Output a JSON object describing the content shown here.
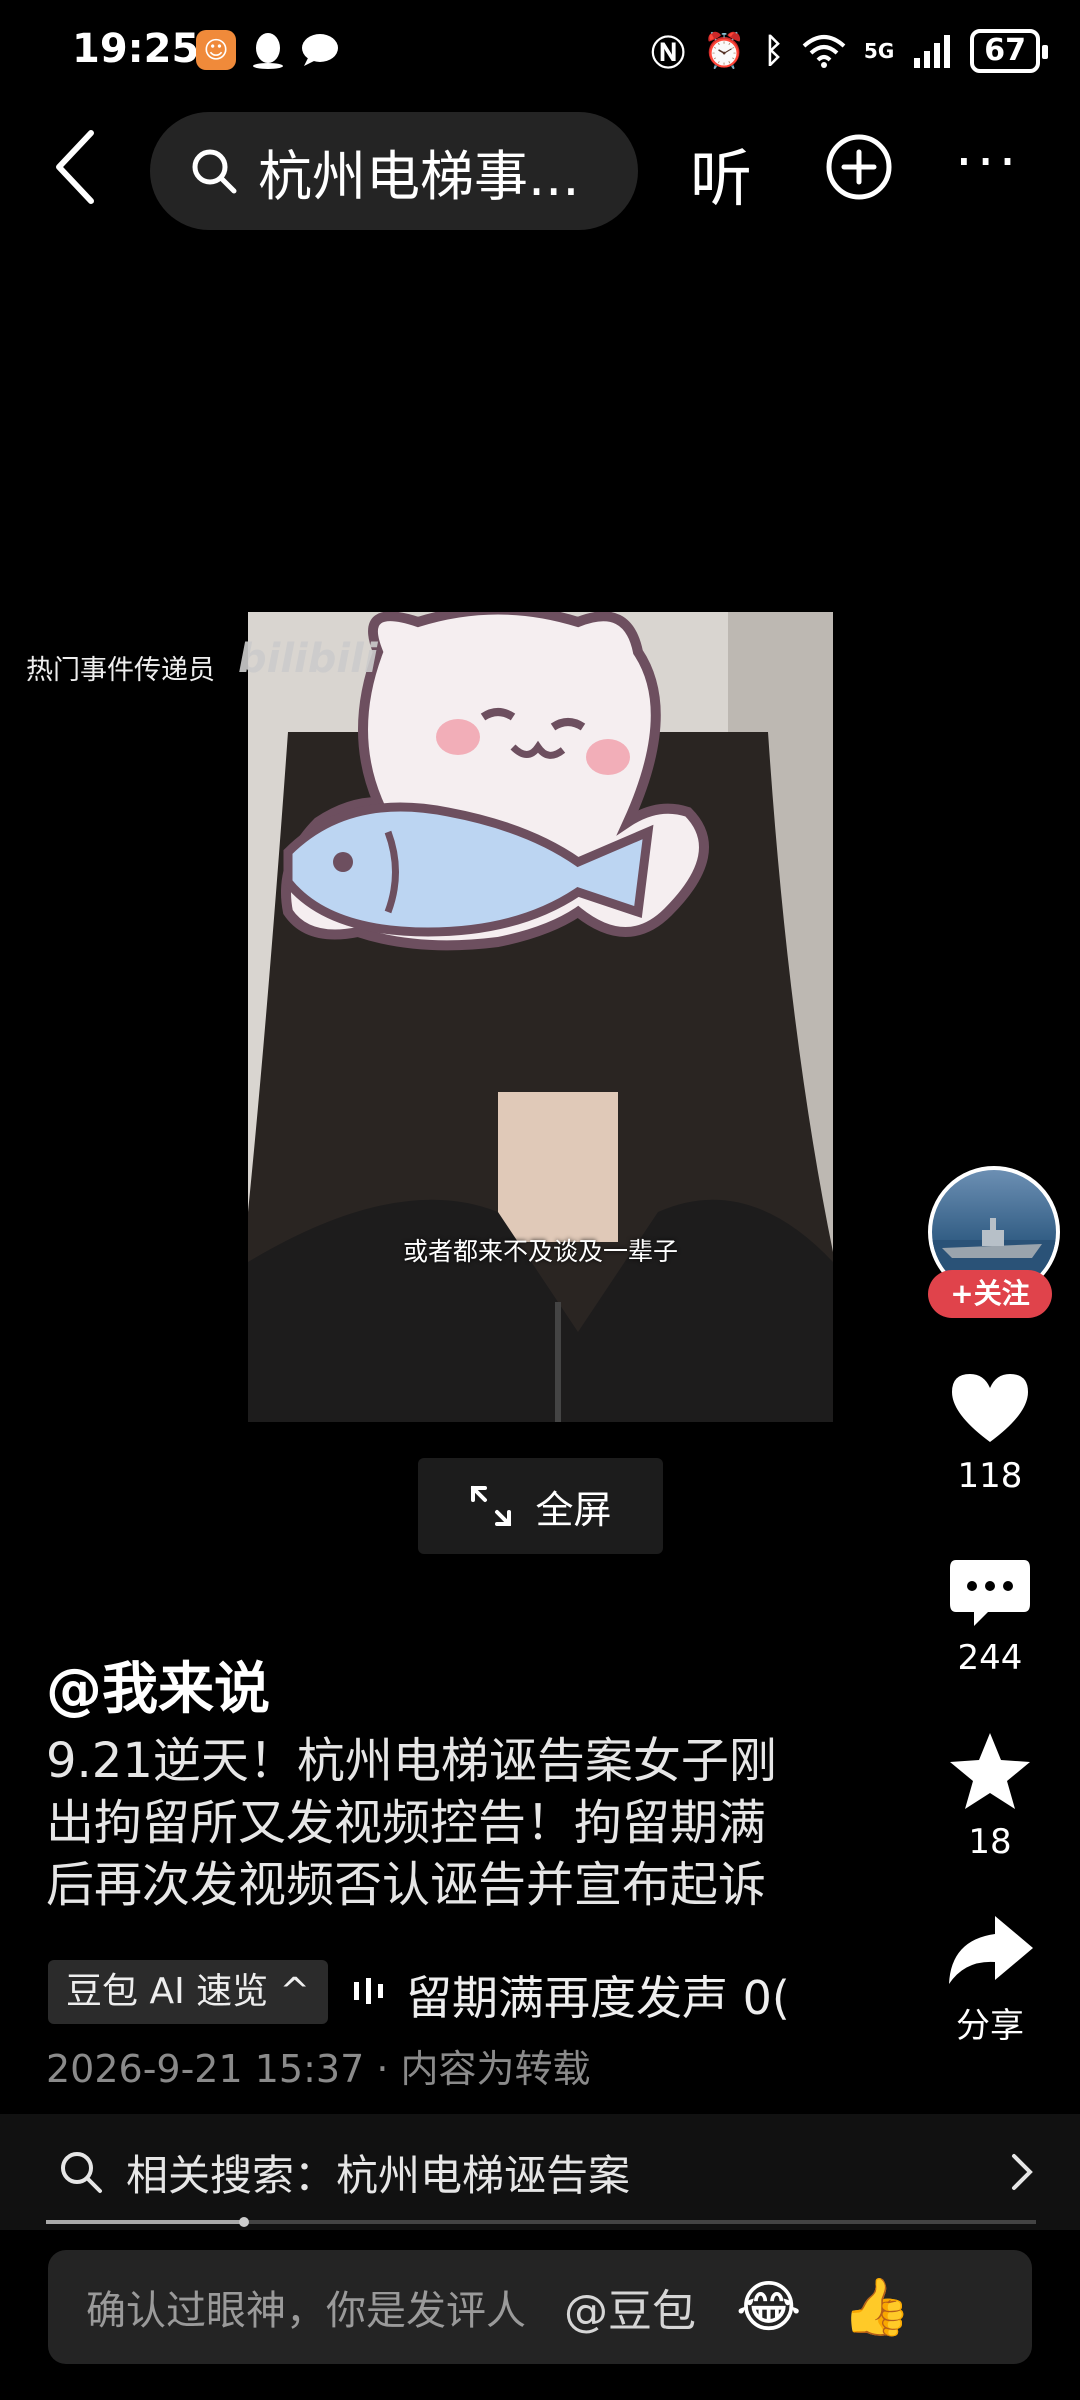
{
  "status_bar": {
    "time": "19:25",
    "network": "5G",
    "battery": "67"
  },
  "header": {
    "search_text": "杭州电梯事...",
    "listen_label": "听"
  },
  "video": {
    "watermark_text": "热门事件传递员",
    "watermark_brand": "bilibili",
    "subtitle": "或者都来不及谈及一辈子",
    "fullscreen_label": "全屏"
  },
  "side_rail": {
    "follow_label": "+关注",
    "likes": "118",
    "comments": "244",
    "favorites": "18",
    "share_label": "分享"
  },
  "post": {
    "author": "@我来说",
    "description": "9.21逆天！杭州电梯诬告案女子刚\n出拘留所又发视频控告！拘留期满\n后再次发视频否认诬告并宣布起诉",
    "ai_tag_label": "豆包 AI 速览 ^",
    "ai_scroll_text": "留期满再度发声    0(",
    "date": "2026-9-21 15:37",
    "source_note": "· 内容为转载"
  },
  "related_search": {
    "label": "相关搜索：杭州电梯诬告案"
  },
  "progress": {
    "fraction": 0.2
  },
  "comment_bar": {
    "placeholder": "确认过眼神，你是发评人",
    "mention": "@豆包"
  }
}
